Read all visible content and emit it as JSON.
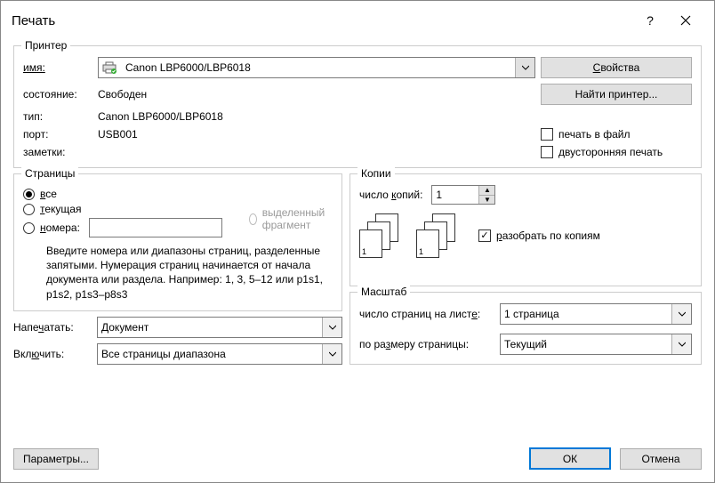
{
  "title": "Печать",
  "printer": {
    "legend": "Принтер",
    "name_label": "имя:",
    "name_value": "Canon LBP6000/LBP6018",
    "state_label": "состояние:",
    "state_value": "Свободен",
    "type_label": "тип:",
    "type_value": "Canon LBP6000/LBP6018",
    "port_label": "порт:",
    "port_value": "USB001",
    "notes_label": "заметки:",
    "notes_value": "",
    "properties_btn": "Свойства",
    "find_btn": "Найти принтер...",
    "print_to_file": "печать в файл",
    "duplex": "двусторонняя печать"
  },
  "pages": {
    "legend": "Страницы",
    "all": "все",
    "current": "текущая",
    "selection": "выделенный фрагмент",
    "numbers": "номера:",
    "hint": "Введите номера или диапазоны страниц, разделенные запятыми. Нумерация страниц начинается от начала документа или раздела. Например: 1, 3, 5–12 или p1s1, p1s2, p1s3–p8s3"
  },
  "copies": {
    "legend": "Копии",
    "count_label": "число копий:",
    "count_value": "1",
    "collate": "разобрать по копиям"
  },
  "print_what": {
    "label": "Напечатать:",
    "value": "Документ"
  },
  "include": {
    "label": "Включить:",
    "value": "Все страницы диапазона"
  },
  "scale": {
    "legend": "Масштаб",
    "pages_per_sheet_label": "число страниц на листе:",
    "pages_per_sheet_value": "1 страница",
    "fit_label": "по размеру страницы:",
    "fit_value": "Текущий"
  },
  "footer": {
    "options": "Параметры...",
    "ok": "ОК",
    "cancel": "Отмена"
  }
}
